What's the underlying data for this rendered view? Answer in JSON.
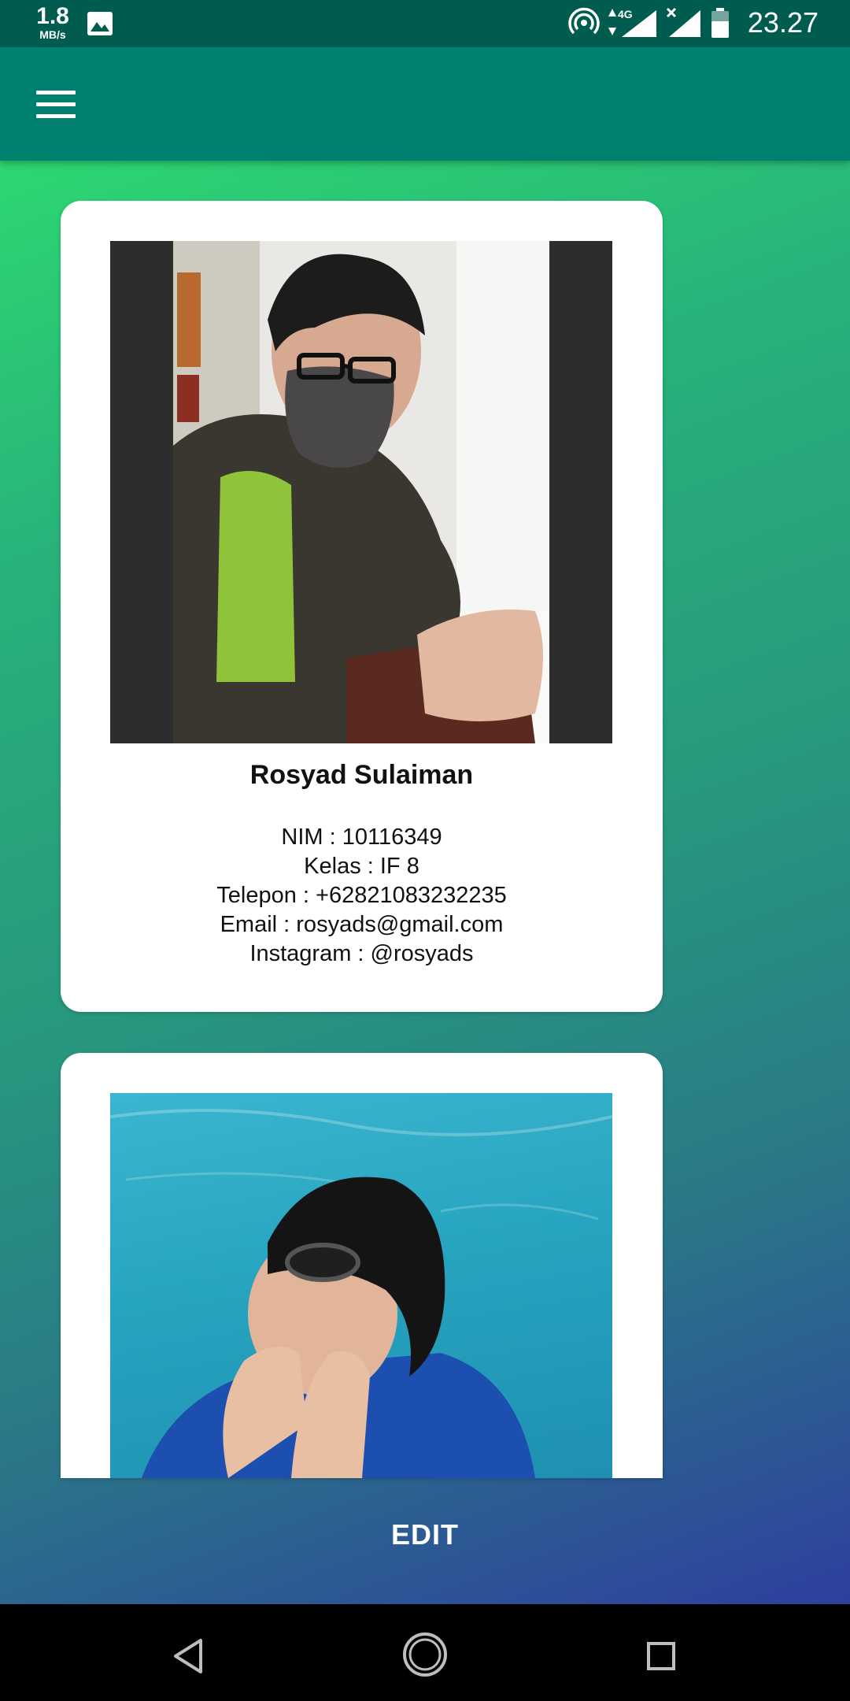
{
  "status_bar": {
    "net_speed": "1.8",
    "net_speed_unit": "MB/s",
    "network_type": "4G",
    "time": "23.27"
  },
  "toolbar": {
    "menu_icon": "hamburger-menu-icon"
  },
  "profiles": [
    {
      "photo_description": "photo of a man wearing a mask and glasses",
      "name": "Rosyad Sulaiman",
      "nim": "NIM : 10116349",
      "kelas": "Kelas : IF 8",
      "telepon": "Telepon : +62821083232235",
      "email": "Email : rosyads@gmail.com",
      "instagram": "Instagram : @rosyads"
    },
    {
      "photo_description": "photo of a man in a swimming pool"
    }
  ],
  "actions": {
    "edit_label": "EDIT"
  },
  "colors": {
    "status_bar": "#005c4f",
    "toolbar": "#00806f",
    "gradient_top": "#2ee66e",
    "gradient_bottom": "#2e3f9e"
  }
}
